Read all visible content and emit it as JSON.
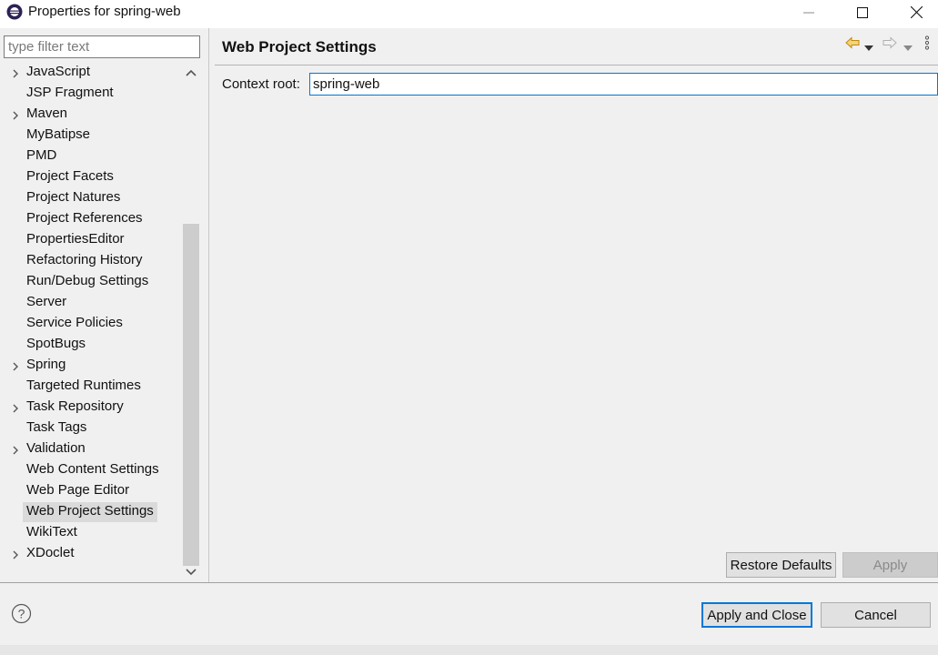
{
  "window": {
    "title": "Properties for spring-web"
  },
  "filter": {
    "placeholder": "type filter text",
    "value": ""
  },
  "tree": {
    "items": [
      {
        "label": "JavaScript",
        "expandable": true
      },
      {
        "label": "JSP Fragment",
        "expandable": false
      },
      {
        "label": "Maven",
        "expandable": true
      },
      {
        "label": "MyBatipse",
        "expandable": false
      },
      {
        "label": "PMD",
        "expandable": false
      },
      {
        "label": "Project Facets",
        "expandable": false
      },
      {
        "label": "Project Natures",
        "expandable": false
      },
      {
        "label": "Project References",
        "expandable": false
      },
      {
        "label": "PropertiesEditor",
        "expandable": false
      },
      {
        "label": "Refactoring History",
        "expandable": false
      },
      {
        "label": "Run/Debug Settings",
        "expandable": false
      },
      {
        "label": "Server",
        "expandable": false
      },
      {
        "label": "Service Policies",
        "expandable": false
      },
      {
        "label": "SpotBugs",
        "expandable": false
      },
      {
        "label": "Spring",
        "expandable": true
      },
      {
        "label": "Targeted Runtimes",
        "expandable": false
      },
      {
        "label": "Task Repository",
        "expandable": true
      },
      {
        "label": "Task Tags",
        "expandable": false
      },
      {
        "label": "Validation",
        "expandable": true
      },
      {
        "label": "Web Content Settings",
        "expandable": false
      },
      {
        "label": "Web Page Editor",
        "expandable": false
      },
      {
        "label": "Web Project Settings",
        "expandable": false,
        "selected": true
      },
      {
        "label": "WikiText",
        "expandable": false
      },
      {
        "label": "XDoclet",
        "expandable": true
      }
    ]
  },
  "page": {
    "title": "Web Project Settings",
    "context_root_label": "Context root:",
    "context_root_value": "spring-web",
    "restore_defaults": "Restore Defaults",
    "apply": "Apply"
  },
  "footer": {
    "apply_and_close": "Apply and Close",
    "cancel": "Cancel"
  },
  "icons": {
    "app": "eclipse-icon",
    "minimize": "minimize-icon",
    "maximize": "maximize-icon",
    "close": "close-icon",
    "back": "back-arrow-icon",
    "forward": "forward-arrow-icon",
    "menu": "view-menu-icon",
    "help": "help-icon"
  },
  "colors": {
    "accent": "#0078d7",
    "back_arrow": "#e8a317"
  }
}
